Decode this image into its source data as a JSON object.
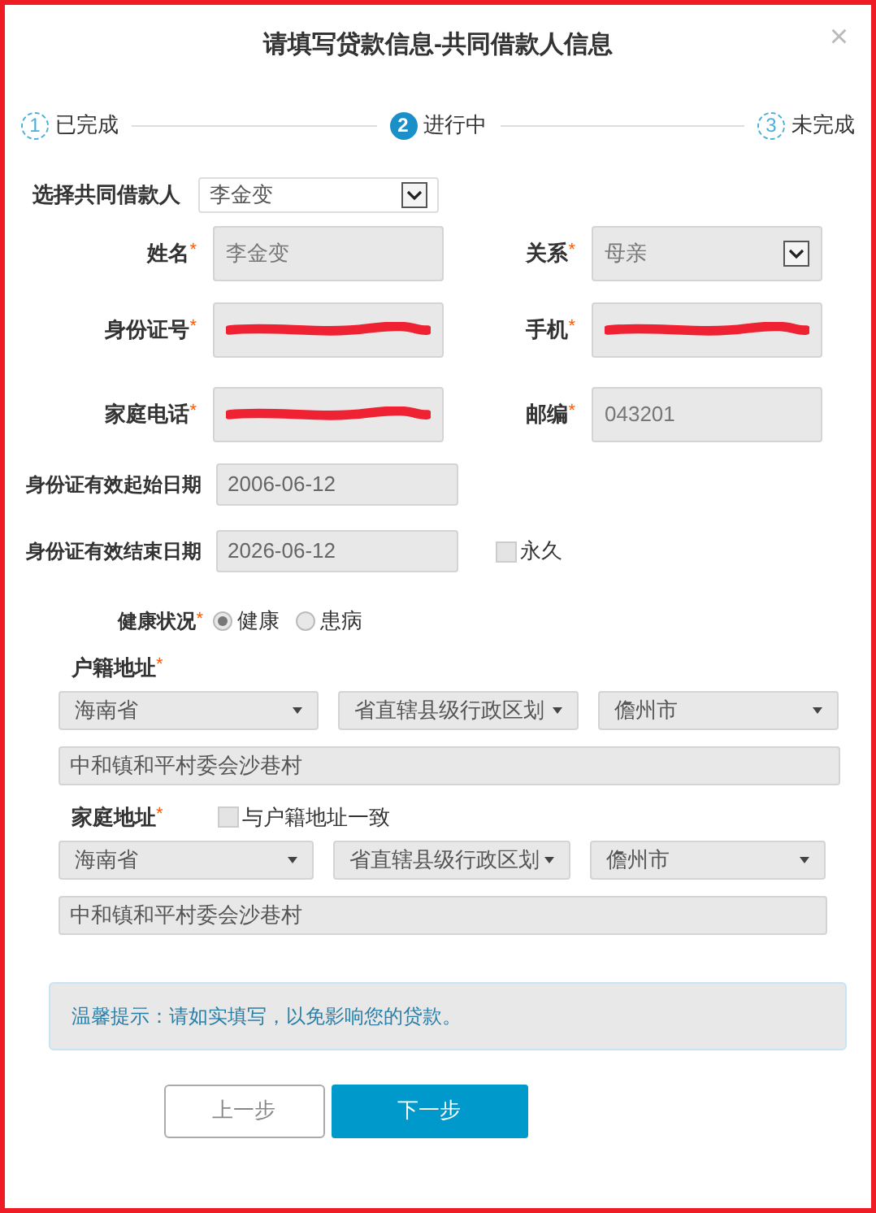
{
  "dialog": {
    "title": "请填写贷款信息-共同借款人信息",
    "close": "×"
  },
  "steps": [
    {
      "number": "1",
      "label": "已完成",
      "current": false
    },
    {
      "number": "2",
      "label": "进行中",
      "current": true
    },
    {
      "number": "3",
      "label": "未完成",
      "current": false
    }
  ],
  "borrower_select": {
    "label": "选择共同借款人",
    "value": "李金变"
  },
  "field_rows": [
    [
      {
        "label": "姓名",
        "mark": "*",
        "value": "李金变",
        "kind": "text",
        "redacted": false
      },
      {
        "label": "关系",
        "mark": "*",
        "value": "母亲",
        "kind": "select",
        "redacted": false
      }
    ],
    [
      {
        "label": "身份证号",
        "mark": "*",
        "kind": "text",
        "redacted": true
      },
      {
        "label": "手机",
        "mark": "*",
        "kind": "text",
        "redacted": true
      }
    ],
    [
      {
        "label": "家庭电话",
        "mark": "*",
        "kind": "text",
        "redacted": true
      },
      {
        "label": "邮编",
        "mark": "*",
        "value": "043201",
        "kind": "text",
        "redacted": false
      }
    ]
  ],
  "id_start": {
    "label": "身份证有效起始日期",
    "value": "2006-06-12"
  },
  "id_end": {
    "label": "身份证有效结束日期",
    "value": "2026-06-12",
    "permanent": {
      "label": "永久",
      "checked": false
    }
  },
  "health": {
    "label": "健康状况",
    "mark": "*",
    "options": [
      {
        "label": "健康",
        "selected": true
      },
      {
        "label": "患病",
        "selected": false
      }
    ]
  },
  "registered_address": {
    "label": "户籍地址",
    "mark": "*",
    "province": "海南省",
    "city": "省直辖县级行政区划",
    "county": "儋州市",
    "detail": "中和镇和平村委会沙巷村"
  },
  "home_address": {
    "label": "家庭地址",
    "mark": "*",
    "same_as": {
      "label": "与户籍地址一致",
      "checked": false
    },
    "province": "海南省",
    "city": "省直辖县级行政区划",
    "county": "儋州市",
    "detail": "中和镇和平村委会沙巷村"
  },
  "tip": "温馨提示：请如实填写，以免影响您的贷款。",
  "buttons": [
    {
      "label": "上一步",
      "kind": "secondary"
    },
    {
      "label": "下一步",
      "kind": "primary"
    }
  ]
}
